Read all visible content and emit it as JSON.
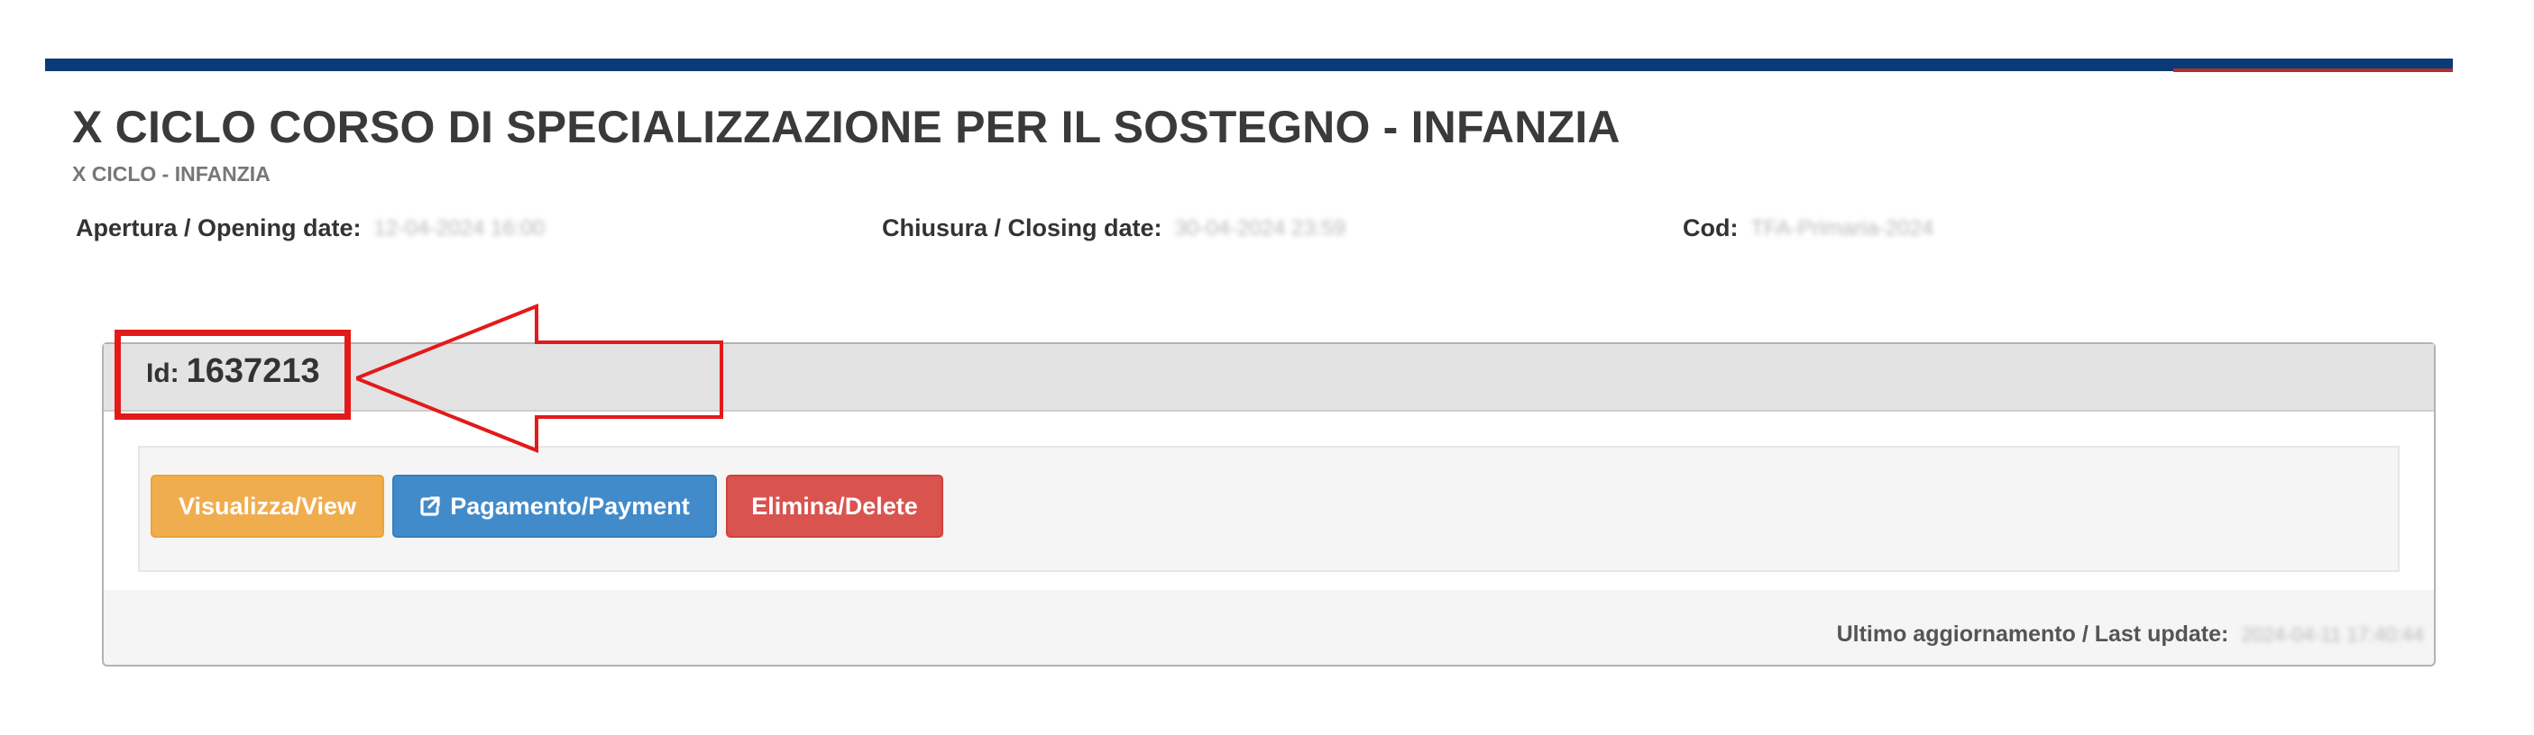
{
  "header": {
    "title": "X CICLO CORSO DI SPECIALIZZAZIONE PER IL SOSTEGNO - INFANZIA",
    "subtitle": "X CICLO - INFANZIA"
  },
  "meta": {
    "opening_label": "Apertura / Opening date:",
    "opening_value": "12-04-2024 16:00",
    "closing_label": "Chiusura / Closing date:",
    "closing_value": "30-04-2024 23:59",
    "code_label": "Cod:",
    "code_value": "TFA-Primaria-2024"
  },
  "application": {
    "id_label": "Id:",
    "id_value": "1637213",
    "buttons": {
      "view_label": "Visualizza/View",
      "payment_label": "Pagamento/Payment",
      "delete_label": "Elimina/Delete"
    },
    "last_update_label": "Ultimo aggiornamento / Last update:",
    "last_update_value": "2024-04-11 17:40:44"
  },
  "icons": {
    "payment_button_icon": "external-link-icon"
  },
  "colors": {
    "top_bar": "#0b3a78",
    "highlight": "#e31a1a",
    "btn_view": "#f0ad4e",
    "btn_payment": "#428bca",
    "btn_delete": "#d9534f"
  }
}
